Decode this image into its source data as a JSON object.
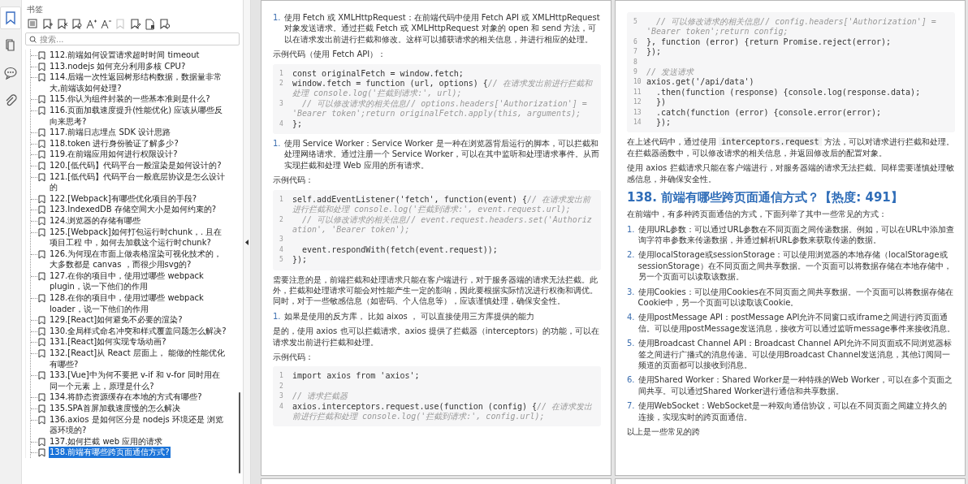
{
  "strip": [
    {
      "kind": "bookmarks",
      "selected": true
    },
    {
      "kind": "pages",
      "selected": false
    },
    {
      "kind": "comments",
      "selected": false
    },
    {
      "kind": "attachments",
      "selected": false
    }
  ],
  "sidebar": {
    "title": "书签",
    "toolbar": [
      {
        "kind": "outline",
        "disabled": false
      },
      {
        "kind": "bookmark_add",
        "disabled": false
      },
      {
        "kind": "bookmark_delete",
        "disabled": false
      },
      {
        "kind": "bookmark_search",
        "disabled": false
      },
      {
        "kind": "font_larger",
        "disabled": false
      },
      {
        "kind": "font_smaller",
        "disabled": false
      },
      {
        "kind": "bookmark_plain",
        "disabled": true
      },
      {
        "kind": "bookmark_edit",
        "disabled": false
      },
      {
        "kind": "page_bookmark",
        "disabled": false
      },
      {
        "kind": "bookmark_settings",
        "disabled": false
      }
    ],
    "search": {
      "placeholder": "搜索..."
    },
    "items": [
      {
        "label": "112.前端如何设置请求超时时间 timeout",
        "selected": false
      },
      {
        "label": "113.nodejs 如何充分利用多核 CPU?",
        "selected": false
      },
      {
        "label": "114.后端一次性返回树形结构数据，数据量非常大,前端该如何处理?",
        "selected": false
      },
      {
        "label": "115.你认为组件封装的一些基本准则是什么?",
        "selected": false
      },
      {
        "label": "116.页面加载速度提升(性能优化) 应该从哪些反向来思考?",
        "selected": false
      },
      {
        "label": "117.前端日志埋点 SDK 设计思路",
        "selected": false
      },
      {
        "label": "118.token 进行身份验证了解多少?",
        "selected": false
      },
      {
        "label": "119.在前端应用如何进行权限设计?",
        "selected": false
      },
      {
        "label": "120.[低代码】代码平台一般渲染是如何设计的?",
        "selected": false
      },
      {
        "label": "121.[低代码】代码平台一般底层协议是怎么设计的",
        "selected": false
      },
      {
        "label": "122.[Webpack]有哪些优化项目的手段?",
        "selected": false
      },
      {
        "label": "123.IndexedDB 存储空间大小是如何约束的?",
        "selected": false
      },
      {
        "label": "124.浏览器的存储有哪些",
        "selected": false
      },
      {
        "label": "125.[Webpack]如何打包运行时chunk，. 且在项目工程 中，如何去加载这个运行时chunk?",
        "selected": false
      },
      {
        "label": "126.为何现在市面上做表格渲染可视化技术的，大多数都是 canvas ，而很少用svg的?",
        "selected": false
      },
      {
        "label": "127.在你的项目中，使用过哪些 webpack plugin，说一下他们的作用",
        "selected": false
      },
      {
        "label": "128.在你的项目中，使用过哪些 webpack loader，说一下他们的作用",
        "selected": false
      },
      {
        "label": "129.[React]如何避免不必要的渲染?",
        "selected": false
      },
      {
        "label": "130.全局样式命名冲突和样式覆盖问题怎么解决?",
        "selected": false
      },
      {
        "label": "131.[React]如何实现专场动画?",
        "selected": false
      },
      {
        "label": "132.[React]从 React 层面上， 能做的性能优化有哪些?",
        "selected": false
      },
      {
        "label": "133.[Vue]中为何不要把 v-if 和 v-for 同时用在同一个元素 上，原理是什么?",
        "selected": false
      },
      {
        "label": "134.将静态资源缓存在本地的方式有哪些?",
        "selected": false
      },
      {
        "label": "135.SPA首屏加载速度慢的怎么解决",
        "selected": false
      },
      {
        "label": "136.axios 是如何区分是 nodejs 环境还是 浏览器环境的?",
        "selected": false
      },
      {
        "label": "137.如何拦截 web 应用的请求",
        "selected": false
      },
      {
        "label": "138.前端有哪些跨页面通信方式?",
        "selected": true
      }
    ]
  },
  "pages": [
    {
      "blocks": [
        {
          "kind": "list_item",
          "number": "1.",
          "text": "使用 Fetch 或 XMLHttpRequest：在前端代码中使用 Fetch API 或 XMLHttpRequest 对象发送请求。通过拦截 Fetch 或 XMLHttpRequest 对象的 open 和 send 方法，可以在请求发出前进行拦截和修改。这样可以捕获请求的相关信息，并进行相应的处理。"
        },
        {
          "kind": "paragraph",
          "text": "示例代码（使用 Fetch API）："
        },
        {
          "kind": "code",
          "lines": [
            {
              "n": "1",
              "text": "const originalFetch = window.fetch;"
            },
            {
              "n": "2",
              "text": "window.fetch = function (url, options) {// 在请求发出前进行拦截和处理 console.log('拦截到请求:', url);"
            },
            {
              "n": "3",
              "text": "  // 可以修改请求的相关信息// options.headers['Authorization'] = 'Bearer token';return originalFetch.apply(this, arguments);"
            },
            {
              "n": "4",
              "text": "};"
            }
          ]
        },
        {
          "kind": "list_item",
          "number": "1.",
          "text": "使用 Service Worker：Service Worker 是一种在浏览器背后运行的脚本，可以拦截和处理网络请求。通过注册一个 Service Worker，可以在其中监听和处理请求事件。从而实现拦截和处理 Web 应用的所有请求。"
        },
        {
          "kind": "paragraph",
          "text": "示例代码："
        },
        {
          "kind": "code",
          "lines": [
            {
              "n": "1",
              "text": "self.addEventListener('fetch', function(event) {// 在请求发出前进行拦截和处理 console.log('拦截到请求:', event.request.url);"
            },
            {
              "n": "2",
              "text": "  // 可以修改请求的相关信息// event.request.headers.set('Authorization', 'Bearer token');"
            },
            {
              "n": "3"
            },
            {
              "n": "4",
              "text": "  event.respondWith(fetch(event.request));"
            },
            {
              "n": "5",
              "text": "});"
            }
          ]
        },
        {
          "kind": "paragraph",
          "text": "需要注意的是，前端拦截和处理请求只能在客户端进行，对于服务器端的请求无法拦截。此外，拦截和处理请求可能会对性能产生一定的影响，因此要根据实际情况进行权衡和调优。同时，对于一些敏感信息（如密码、个人信息等），应该谨慎处理，确保安全性。"
        },
        {
          "kind": "list_item",
          "number": "1.",
          "text": "如果是使用的反方库， 比如 aixos ， 可以直接使用三方库提供的能力"
        },
        {
          "kind": "paragraph",
          "text": "是的，使用 axios 也可以拦截请求。axios 提供了拦截器（interceptors）的功能，可以在请求发出前进行拦截和处理。"
        },
        {
          "kind": "paragraph",
          "text": "示例代码："
        },
        {
          "kind": "code",
          "lines": [
            {
              "n": "1",
              "text": "import axios from 'axios';"
            },
            {
              "n": "2"
            },
            {
              "n": "3",
              "text": "// 请求拦截器"
            },
            {
              "n": "4",
              "text": "axios.interceptors.request.use(function (config) {// 在请求发出前进行拦截和处理 console.log('拦截到请求:', config.url);"
            }
          ]
        }
      ]
    },
    {
      "blocks": [
        {
          "kind": "code",
          "lines": [
            {
              "n": "5",
              "text": "  // 可以修改请求的相关信息// config.headers['Authorization'] = 'Bearer token';return config;"
            },
            {
              "n": "6",
              "text": "}, function (error) {return Promise.reject(error);"
            },
            {
              "n": "7",
              "text": "});"
            },
            {
              "n": "8"
            },
            {
              "n": "9",
              "text": "// 发送请求"
            },
            {
              "n": "10",
              "text": "axios.get('/api/data')"
            },
            {
              "n": "11",
              "text": "  .then(function (response) {console.log(response.data);"
            },
            {
              "n": "12",
              "text": "  })"
            },
            {
              "n": "13",
              "text": "  .catch(function (error) {console.error(error);"
            },
            {
              "n": "14",
              "text": "  });"
            }
          ]
        },
        {
          "kind": "rich_paragraph",
          "parts": [
            {
              "kind": "text",
              "text": "在上述代码中，通过使用 "
            },
            {
              "kind": "code",
              "text": "interceptors.request"
            },
            {
              "kind": "text",
              "text": " 方法，可以对请求进行拦截和处理。在拦截器函数中，可以修改请求的相关信息，并返回修改后的配置对象。"
            }
          ]
        },
        {
          "kind": "paragraph",
          "text": "使用 axios 拦截请求只能在客户端进行，对服务器端的请求无法拦截。同样需要谨慎处理敏感信息，并确保安全性。"
        },
        {
          "kind": "heading",
          "text": "138. 前端有哪些跨页面通信方式？【热度: 491】"
        },
        {
          "kind": "paragraph",
          "text": "在前端中，有多种跨页面通信的方式，下面列举了其中一些常见的方式："
        },
        {
          "kind": "list_item",
          "number": "1.",
          "text": "使用URL参数：可以通过URL参数在不同页面之间传递数据。例如，可以在URL中添加查询字符串参数来传递数据，并通过解析URL参数来获取传递的数据。"
        },
        {
          "kind": "list_item",
          "number": "2.",
          "text": "使用localStorage或sessionStorage：可以使用浏览器的本地存储（localStorage或sessionStorage）在不同页面之间共享数据。一个页面可以将数据存储在本地存储中，另一个页面可以读取该数据。"
        },
        {
          "kind": "list_item",
          "number": "3.",
          "text": "使用Cookies：可以使用Cookies在不同页面之间共享数据。一个页面可以将数据存储在Cookie中，另一个页面可以读取该Cookie。"
        },
        {
          "kind": "list_item",
          "number": "4.",
          "text": "使用postMessage API：postMessage API允许不同窗口或iframe之间进行跨页面通信。可以使用postMessage发送消息，接收方可以通过监听message事件来接收消息。"
        },
        {
          "kind": "list_item",
          "number": "5.",
          "text": "使用Broadcast Channel API：Broadcast Channel API允许不同页面或不同浏览器标签之间进行广播式的消息传递。可以使用Broadcast Channel发送消息，其他订阅同一频道的页面都可以接收到消息。"
        },
        {
          "kind": "list_item",
          "number": "6.",
          "text": "使用Shared Worker：Shared Worker是一种特殊的Web Worker，可以在多个页面之间共享。可以通过Shared Worker进行通信和共享数据。"
        },
        {
          "kind": "list_item",
          "number": "7.",
          "text": "使用WebSocket：WebSocket是一种双向通信协议，可以在不同页面之间建立持久的连接，实现实时的跨页面通信。"
        },
        {
          "kind": "paragraph",
          "text": "以上是一些常见的跨"
        }
      ]
    }
  ]
}
